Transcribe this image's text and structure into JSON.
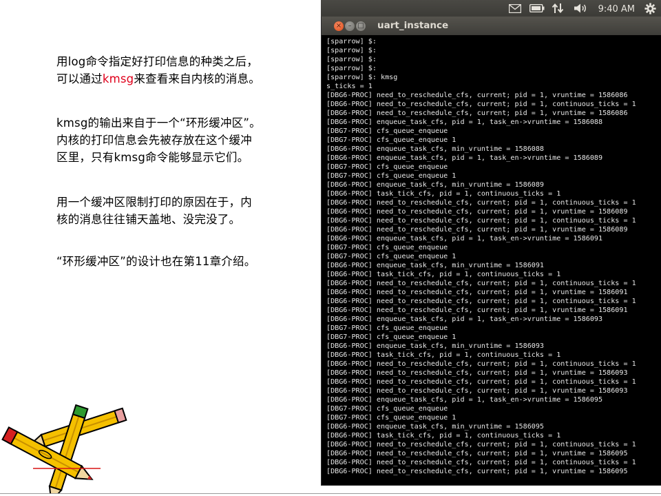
{
  "slide": {
    "p1": {
      "a": "用log命令指定好打印信息的种类之后，",
      "b": "可以通过",
      "kmsg": "kmsg",
      "c": "来查看来自内核的消息。"
    },
    "p2": {
      "a": "kmsg的输出来自于一个“环形缓冲区”。",
      "b": "内核的打印信息会先被存放在这个缓冲",
      "c": "区里，只有kmsg命令能够显示它们。"
    },
    "p3": {
      "a": "用一个缓冲区限制打印的原因在于，内",
      "b": "核的消息往往铺天盖地、没完没了。"
    },
    "p4": {
      "a": "“环形缓冲区”的设计也在第11章介绍。"
    }
  },
  "panel": {
    "clock": "9:40 AM",
    "icons": [
      "mail-icon",
      "battery-icon",
      "network-icon",
      "volume-icon",
      "gear-icon"
    ]
  },
  "window": {
    "title": "uart_instance",
    "close_glyph": "×",
    "min_glyph": "–",
    "max_glyph": "□"
  },
  "terminal": {
    "lines": [
      "[sparrow] $:",
      "[sparrow] $:",
      "[sparrow] $:",
      "[sparrow] $:",
      "[sparrow] $: kmsg",
      "s_ticks = 1",
      "[DBG6-PROC] need_to_reschedule_cfs, current; pid = 1, vruntime = 1586086",
      "[DBG6-PROC] need_to_reschedule_cfs, current; pid = 1, continuous_ticks = 1",
      "[DBG6-PROC] need_to_reschedule_cfs, current; pid = 1, vruntime = 1586086",
      "[DBG6-PROC] enqueue_task_cfs, pid = 1, task_en->vruntime = 1586088",
      "[DBG7-PROC] cfs_queue_enqueue",
      "[DBG7-PROC] cfs_queue_enqueue 1",
      "[DBG6-PROC] enqueue_task_cfs, min_vruntime = 1586088",
      "[DBG6-PROC] enqueue_task_cfs, pid = 1, task_en->vruntime = 1586089",
      "[DBG7-PROC] cfs_queue_enqueue",
      "[DBG7-PROC] cfs_queue_enqueue 1",
      "[DBG6-PROC] enqueue_task_cfs, min_vruntime = 1586089",
      "[DBG6-PROC] task_tick_cfs, pid = 1, continuous_ticks = 1",
      "[DBG6-PROC] need_to_reschedule_cfs, current; pid = 1, continuous_ticks = 1",
      "[DBG6-PROC] need_to_reschedule_cfs, current; pid = 1, vruntime = 1586089",
      "[DBG6-PROC] need_to_reschedule_cfs, current; pid = 1, continuous_ticks = 1",
      "[DBG6-PROC] need_to_reschedule_cfs, current; pid = 1, vruntime = 1586089",
      "[DBG6-PROC] enqueue_task_cfs, pid = 1, task_en->vruntime = 1586091",
      "[DBG7-PROC] cfs_queue_enqueue",
      "[DBG7-PROC] cfs_queue_enqueue 1",
      "[DBG6-PROC] enqueue_task_cfs, min_vruntime = 1586091",
      "[DBG6-PROC] task_tick_cfs, pid = 1, continuous_ticks = 1",
      "[DBG6-PROC] need_to_reschedule_cfs, current; pid = 1, continuous_ticks = 1",
      "[DBG6-PROC] need_to_reschedule_cfs, current; pid = 1, vruntime = 1586091",
      "[DBG6-PROC] need_to_reschedule_cfs, current; pid = 1, continuous_ticks = 1",
      "[DBG6-PROC] need_to_reschedule_cfs, current; pid = 1, vruntime = 1586091",
      "[DBG6-PROC] enqueue_task_cfs, pid = 1, task_en->vruntime = 1586093",
      "[DBG7-PROC] cfs_queue_enqueue",
      "[DBG7-PROC] cfs_queue_enqueue 1",
      "[DBG6-PROC] enqueue_task_cfs, min_vruntime = 1586093",
      "[DBG6-PROC] task_tick_cfs, pid = 1, continuous_ticks = 1",
      "[DBG6-PROC] need_to_reschedule_cfs, current; pid = 1, continuous_ticks = 1",
      "[DBG6-PROC] need_to_reschedule_cfs, current; pid = 1, vruntime = 1586093",
      "[DBG6-PROC] need_to_reschedule_cfs, current; pid = 1, continuous_ticks = 1",
      "[DBG6-PROC] need_to_reschedule_cfs, current; pid = 1, vruntime = 1586093",
      "[DBG6-PROC] enqueue_task_cfs, pid = 1, task_en->vruntime = 1586095",
      "[DBG7-PROC] cfs_queue_enqueue",
      "[DBG7-PROC] cfs_queue_enqueue 1",
      "[DBG6-PROC] enqueue_task_cfs, min_vruntime = 1586095",
      "[DBG6-PROC] task_tick_cfs, pid = 1, continuous_ticks = 1",
      "[DBG6-PROC] need_to_reschedule_cfs, current; pid = 1, continuous_ticks = 1",
      "[DBG6-PROC] need_to_reschedule_cfs, current; pid = 1, vruntime = 1586095",
      "[DBG6-PROC] need_to_reschedule_cfs, current; pid = 1, continuous_ticks = 1",
      "[DBG6-PROC] need_to_reschedule_cfs, current; pid = 1, vruntime = 1586095"
    ]
  }
}
